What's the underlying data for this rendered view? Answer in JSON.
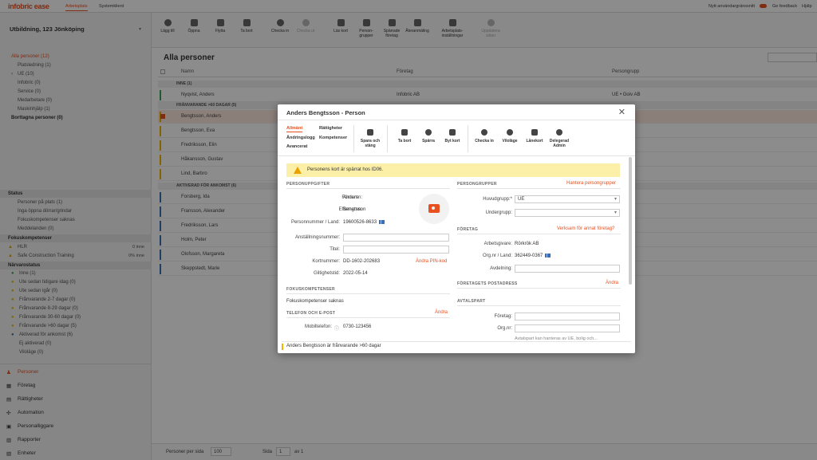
{
  "topbar": {
    "logo": "infobric ease",
    "tabs": [
      "Arbetsplats",
      "Systemklient"
    ],
    "new_interface": "Nytt användargränssnitt",
    "feedback": "Ge feedback",
    "help": "Hjälp"
  },
  "sidebar": {
    "location": "Utbildning, 123 Jönköping",
    "tree": [
      {
        "label": "Alla personer (12)",
        "active": true
      },
      {
        "label": "Platsledning (1)"
      },
      {
        "label": "UE (10)"
      },
      {
        "label": "Infobric (0)"
      },
      {
        "label": "Service (0)"
      },
      {
        "label": "Medarbetare (0)"
      },
      {
        "label": "Maskinhjälp (1)"
      },
      {
        "label": "Borttagna personer (0)"
      }
    ],
    "status_title": "Status",
    "status_items": [
      "Personer på plats (1)",
      "Inga öppna dörrar/grindar",
      "Fokuskompetenser saknas",
      "Meddelanden (0)"
    ],
    "focus_title": "Fokuskompetenser",
    "focus_items": [
      {
        "label": "HLR",
        "value": "0 inne"
      },
      {
        "label": "Safe Construction Training",
        "value": "0% inne"
      }
    ],
    "presence_title": "Närvarostatus",
    "presence_items": [
      "Inne (1)",
      "Ute sedan tidigare idag (0)",
      "Ute sedan igår (0)",
      "Frånvarande 2-7 dagar (0)",
      "Frånvarande 8-29 dagar (0)",
      "Frånvarande 30-60 dagar (0)",
      "Frånvarande >60 dagar (5)",
      "Aktiverad för ankomst (6)",
      "Ej aktiverad (0)",
      "Viloläge (0)"
    ],
    "nav": [
      "Personer",
      "Företag",
      "Rättigheter",
      "Automation",
      "Personalliggare",
      "Rapporter",
      "Enheter"
    ]
  },
  "toolbar": {
    "buttons": [
      "Lägg till",
      "Öppna",
      "Flytta",
      "Ta bort",
      "Checka in",
      "Checka ut",
      "Läs kort",
      "Person-grupper",
      "Spärrade företag",
      "Återanmäling",
      "Arbetsplats-inställningar",
      "Uppdatera sidan"
    ]
  },
  "main": {
    "title": "Alla personer",
    "columns": [
      "Namn",
      "Företag",
      "Persongrupp"
    ],
    "groups": [
      "INNE (1)",
      "FRÅNVARANDE >60 DAGAR (5)",
      "AKTIVERAD FÖR ANKOMST (6)"
    ],
    "rows_inne": [
      {
        "name": "Nyqvist, Anders",
        "company": "Infobric AB",
        "group": "UE • Goiv AB"
      }
    ],
    "rows_absent": [
      "Bengtsson, Anders",
      "Bengtsson, Eva",
      "Fredriksson, Elin",
      "Håkansson, Gustav",
      "Lind, Barbro"
    ],
    "rows_active": [
      "Forsberg, Ida",
      "Fransson, Alexander",
      "Fredriksson, Lars",
      "Holm, Peter",
      "Olofsson, Margareta",
      "Skeppstedt, Marie"
    ],
    "pager": {
      "per_page_label": "Personer per sida",
      "per_page": "100",
      "page_label": "Sida",
      "page": "1",
      "of_label": "av 1"
    }
  },
  "dialog": {
    "title": "Anders Bengtsson - Person",
    "tabs": [
      "Allmänt",
      "Rättigheter",
      "Ändringslogg",
      "Kompetenser",
      "Avancerat"
    ],
    "buttons": [
      "Spara och stäng",
      "Ta bort",
      "Spärra",
      "Byt kort",
      "Checka in",
      "Viloläge",
      "Lånekort",
      "Delegerad Admin"
    ],
    "alert": "Personens kort är spärrat hos ID06.",
    "personal": {
      "section": "PERSONUPPGIFTER",
      "first_name_label": "Förnamn:",
      "first_name": "Anders",
      "last_name_label": "Efternamn:",
      "last_name": "Bengtsson",
      "pnr_label": "Personnummer / Land:",
      "pnr": "19600526-8633",
      "emp_label": "Anställningsnummer:",
      "title_label": "Titel:",
      "card_label": "Kortnummer:",
      "card": "DD-1602-202683",
      "pin_link": "Ändra PIN-kod",
      "valid_label": "Giltighetstid:",
      "valid": "2022-05-14"
    },
    "focus": {
      "section": "FOKUSKOMPETENSER",
      "text": "Fokuskompetenser saknas"
    },
    "contact": {
      "section": "TELEFON OCH E-POST",
      "link": "Ändra",
      "mobile_label": "Mobiltelefon:",
      "mobile": "0730-123456"
    },
    "groups": {
      "section": "PERSONGRUPPER",
      "link": "Hantera persongrupper",
      "main_label": "Huvudgrupp:*",
      "main": "UE",
      "sub_label": "Undergrupp:"
    },
    "company": {
      "section": "FÖRETAG",
      "link": "Verksam för annat företag?",
      "employer_label": "Arbetsgivare:",
      "employer": "Rörkrök AB",
      "org_label": "Org.nr / Land:",
      "org": "362449-0367",
      "dept_label": "Avdelning:"
    },
    "postal": {
      "section": "FÖRETAGETS POSTADRESS",
      "link": "Ändra"
    },
    "contract": {
      "section": "AVTALSPART",
      "company_label": "Företag:",
      "org_label": "Org.nr:",
      "note": "Avtalspart kan hanteras av UE, bolig och..."
    },
    "footer": "Anders Bengtsson är frånvarande >60 dagar"
  }
}
